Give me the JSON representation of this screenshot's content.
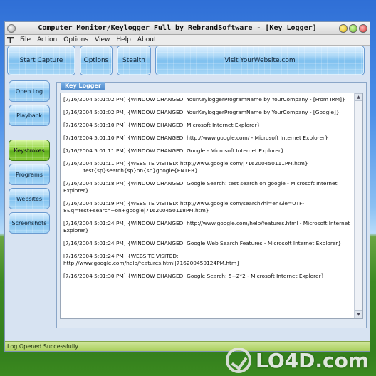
{
  "window": {
    "title": "Computer Monitor/Keylogger Full by RebrandSoftware - [Key Logger]"
  },
  "menu": [
    "File",
    "Action",
    "Options",
    "View",
    "Help",
    "About"
  ],
  "toolbar": {
    "start_capture": "Start Capture",
    "options": "Options",
    "stealth": "Stealth",
    "visit_website": "Visit YourWebsite.com"
  },
  "sidebar": {
    "items": [
      {
        "label": "Open Log",
        "active": false
      },
      {
        "label": "Playback",
        "active": false
      },
      {
        "label": "Keystrokes",
        "active": true
      },
      {
        "label": "Programs",
        "active": false
      },
      {
        "label": "Websites",
        "active": false
      },
      {
        "label": "Screenshots",
        "active": false
      }
    ]
  },
  "panel": {
    "title": "Key Logger",
    "log_entries": [
      "[7/16/2004 5:01:02 PM] {WINDOW CHANGED: YourKeyloggerProgramName by YourCompany - [From IRM]}",
      "[7/16/2004 5:01:02 PM] {WINDOW CHANGED: YourKeyloggerProgramName by YourCompany - [Google]}",
      "[7/16/2004 5:01:10 PM] {WINDOW CHANGED: Microsoft Internet Explorer}",
      "[7/16/2004 5:01:10 PM] {WINDOW CHANGED: http://www.google.com/ - Microsoft Internet Explorer}",
      "[7/16/2004 5:01:11 PM] {WINDOW CHANGED: Google - Microsoft Internet Explorer}",
      "[7/16/2004 5:01:11 PM] {WEBSITE VISITED: http://www.google.com/|716200450111PM.htm}\n            test{sp}search{sp}on{sp}google{ENTER}",
      "[7/16/2004 5:01:18 PM] {WINDOW CHANGED: Google Search: test search on google - Microsoft Internet Explorer}",
      "[7/16/2004 5:01:19 PM] {WEBSITE VISITED: http://www.google.com/search?hl=en&ie=UTF-8&q=test+search+on+google|716200450118PM.htm}",
      "[7/16/2004 5:01:24 PM] {WINDOW CHANGED: http://www.google.com/help/features.html - Microsoft Internet Explorer}",
      "[7/16/2004 5:01:24 PM] {WINDOW CHANGED: Google Web Search Features - Microsoft Internet Explorer}",
      "[7/16/2004 5:01:24 PM] {WEBSITE VISITED: http://www.google.com/help/features.html|716200450124PM.htm}",
      "[7/16/2004 5:01:30 PM] {WINDOW CHANGED: Google Search: 5+2*2 - Microsoft Internet Explorer}"
    ]
  },
  "status": {
    "text": "Log Opened Successfully"
  },
  "watermark": {
    "text": "LO4D.com"
  }
}
